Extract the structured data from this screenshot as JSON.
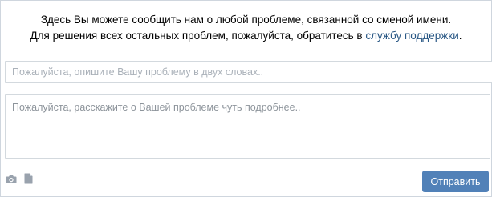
{
  "intro": {
    "line1": "Здесь Вы можете сообщить нам о любой проблеме, связанной со сменой имени.",
    "line2_prefix": "Для решения всех остальных проблем, пожалуйста, обратитесь в ",
    "support_link": "службу поддержки",
    "line2_suffix": "."
  },
  "form": {
    "subject_placeholder": "Пожалуйста, опишите Вашу проблему в двух словах..",
    "subject_value": "",
    "details_placeholder": "Пожалуйста, расскажите о Вашей проблеме чуть подробнее..",
    "details_value": ""
  },
  "attachments": [
    {
      "icon": "camera-icon",
      "label": "photo"
    },
    {
      "icon": "document-icon",
      "label": "document"
    }
  ],
  "actions": {
    "send_label": "Отправить"
  },
  "colors": {
    "accent": "#5181b8",
    "link": "#2a5885",
    "border": "#d3d9de",
    "icon": "#99a2ad"
  }
}
